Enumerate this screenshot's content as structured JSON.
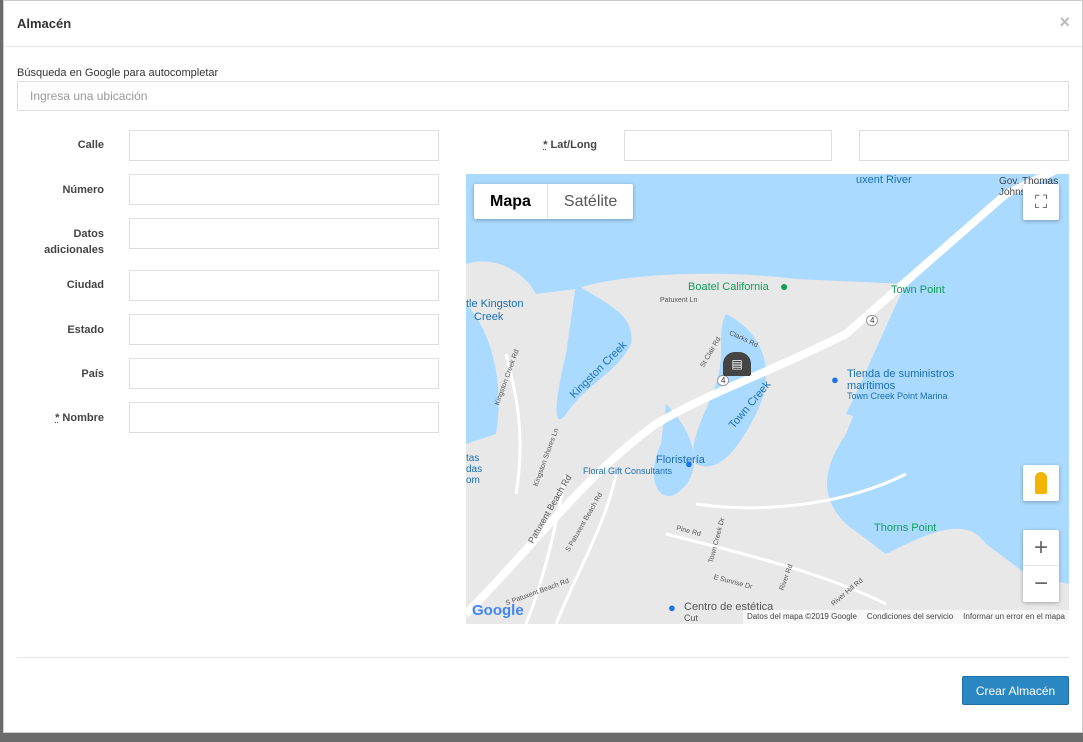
{
  "modal": {
    "title": "Almacén",
    "close": "×"
  },
  "search": {
    "label": "Búsqueda en Google para autocompletar",
    "placeholder": "Ingresa una ubicación"
  },
  "form": {
    "calle": "Calle",
    "numero": "Número",
    "datos_line1": "Datos",
    "datos_line2": "adicionales",
    "ciudad": "Ciudad",
    "estado": "Estado",
    "pais": "País",
    "nombre_req": "*",
    "nombre": " Nombre",
    "latlong_req": "*",
    "latlong": " Lat/Long"
  },
  "map": {
    "tab_map": "Mapa",
    "tab_satellite": "Satélite",
    "labels": {
      "river": "uxent River",
      "gov": "Gov. Thomas",
      "gov2": "Johns",
      "boatel": "Boatel California",
      "town_point": "Town Point",
      "kingston": "tle Kingston",
      "creek": "Creek",
      "kingston_creek": "Kingston Creek",
      "town_creek": "Town Creek",
      "tienda1": "Tienda de suministros",
      "tienda2": "marítimos",
      "tienda3": "Town Creek Point Marina",
      "floristeria": "Floristería",
      "floral": "Floral Gift Consultants",
      "thorns": "Thorns Point",
      "centro": "Centro de estética",
      "cut": "Cut",
      "patuxent": "Patuxent Beach Rd",
      "s_patuxent": "S Patuxent Beach Rd",
      "patuxent_ln": "Patuxent Ln",
      "clarks": "Clarks Rd",
      "st_clair": "St Clair Rd",
      "kingston_creek_rd": "Kingston Creek Rd",
      "kingston_shores": "Kingston Shores Ln",
      "pine": "Pine Rd",
      "town_creek_dr": "Town Creek Dr",
      "sunrise": "E Sunrise Dr",
      "river_rd": "River Rd",
      "river_hill": "River Hill Rd",
      "route4": "4",
      "route4b": "4",
      "tas1": "tas",
      "tas2": "das",
      "tas3": "om"
    },
    "google": "Google",
    "attribution": [
      "Datos del mapa ©2019 Google",
      "Condiciones del servicio",
      "Informar un error en el mapa"
    ]
  },
  "footer": {
    "create_button": "Crear Almacén"
  },
  "colors": {
    "water": "#aadaff",
    "land": "#e8e8e8",
    "primary": "#2a87c1",
    "green": "#0f9d58"
  }
}
